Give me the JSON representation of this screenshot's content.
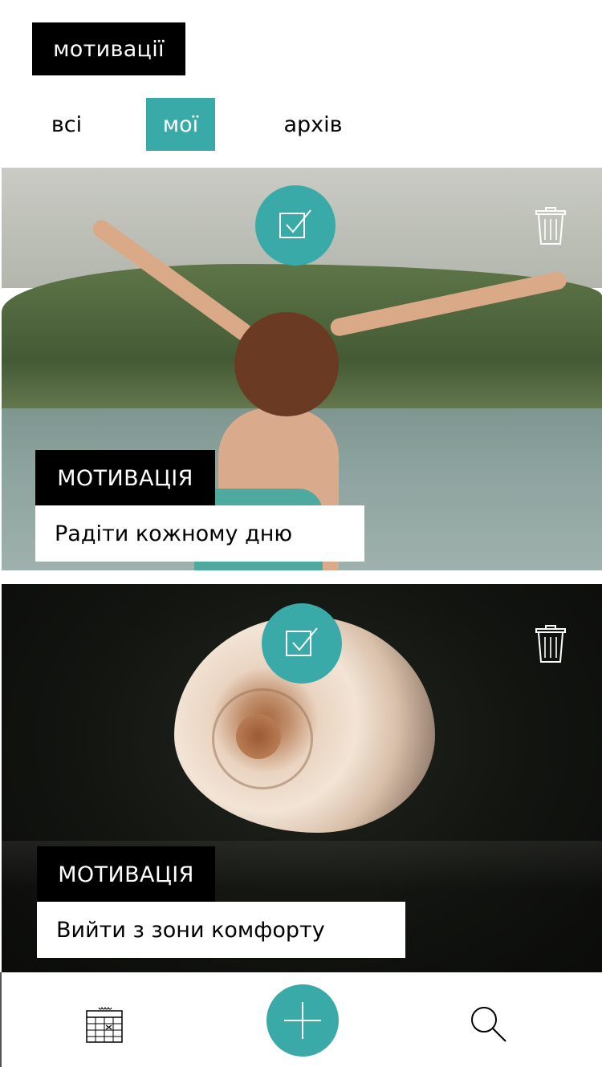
{
  "header": {
    "title": "мотивації"
  },
  "tabs": [
    {
      "label": "всі",
      "active": false
    },
    {
      "label": "мої",
      "active": true
    },
    {
      "label": "архів",
      "active": false
    }
  ],
  "cards": [
    {
      "badge": "МОТИВАЦІЯ",
      "caption": "Радіти кожному дню",
      "photo": "girl-lake-photo",
      "check_icon": "checkbox-icon",
      "delete_icon": "trash-icon"
    },
    {
      "badge": "МОТИВАЦІЯ",
      "caption": "Вийти з зони комфорту",
      "photo": "shell-photo",
      "check_icon": "checkbox-icon",
      "delete_icon": "trash-icon"
    }
  ],
  "bottom_nav": {
    "items": [
      "calendar-icon",
      "plus-icon",
      "search-icon"
    ]
  },
  "colors": {
    "accent": "#3aaaa8",
    "badge_bg": "#000000",
    "text": "#000000"
  }
}
